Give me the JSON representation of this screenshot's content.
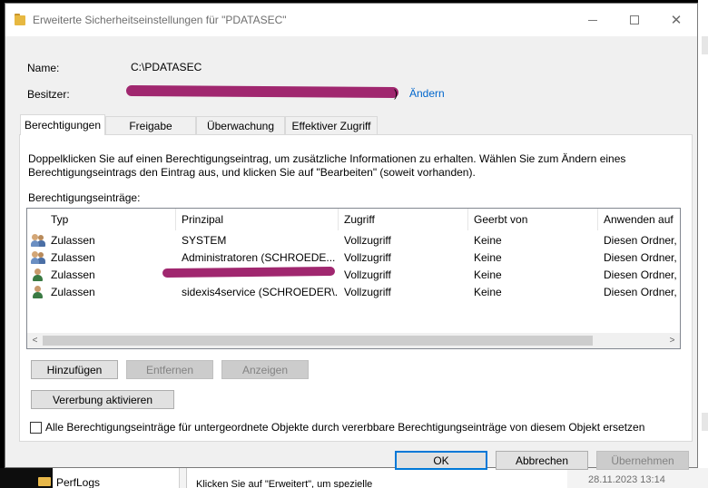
{
  "window": {
    "title": "Erweiterte Sicherheitseinstellungen für \"PDATASEC\"",
    "minimize_glyph": "—",
    "maximize_glyph": "☐",
    "close_glyph": "✕"
  },
  "header": {
    "name_label": "Name:",
    "name_value": "C:\\PDATASEC",
    "owner_label": "Besitzer:",
    "owner_value_tail": ")",
    "change_link": "Ändern"
  },
  "tabs": [
    {
      "label": "Berechtigungen",
      "active": true
    },
    {
      "label": "Freigabe",
      "active": false
    },
    {
      "label": "Überwachung",
      "active": false
    },
    {
      "label": "Effektiver Zugriff",
      "active": false
    }
  ],
  "permissions": {
    "instruction": "Doppelklicken Sie auf einen Berechtigungseintrag, um zusätzliche Informationen zu erhalten. Wählen Sie zum Ändern eines Berechtigungseintrags den Eintrag aus, und klicken Sie auf \"Bearbeiten\" (soweit vorhanden).",
    "entries_label": "Berechtigungseinträge:",
    "columns": [
      "Typ",
      "Prinzipal",
      "Zugriff",
      "Geerbt von",
      "Anwenden auf"
    ],
    "rows": [
      {
        "icon": "group-icon",
        "type": "Zulassen",
        "principal": "SYSTEM",
        "access": "Vollzugriff",
        "inherited": "Keine",
        "applies": "Diesen Ordner, U"
      },
      {
        "icon": "group-icon",
        "type": "Zulassen",
        "principal": "Administratoren (SCHROEDE...",
        "access": "Vollzugriff",
        "inherited": "Keine",
        "applies": "Diesen Ordner, U"
      },
      {
        "icon": "user-icon",
        "type": "Zulassen",
        "principal": "",
        "access": "Vollzugriff",
        "inherited": "Keine",
        "applies": "Diesen Ordner, U"
      },
      {
        "icon": "user-icon",
        "type": "Zulassen",
        "principal": "sidexis4service (SCHROEDER\\...",
        "access": "Vollzugriff",
        "inherited": "Keine",
        "applies": "Diesen Ordner, U"
      }
    ],
    "scroll_left": "<",
    "scroll_right": ">",
    "buttons": {
      "add": "Hinzufügen",
      "remove": "Entfernen",
      "view": "Anzeigen",
      "inherit": "Vererbung aktivieren"
    },
    "replace_checkbox_label": "Alle Berechtigungseinträge für untergeordnete Objekte durch vererbbare Berechtigungseinträge von diesem Objekt ersetzen",
    "replace_checked": false
  },
  "footer": {
    "ok": "OK",
    "cancel": "Abbrechen",
    "apply": "Übernehmen"
  },
  "background": {
    "folder_label": "PerfLogs",
    "mid_text": "Klicken Sie auf \"Erweitert\", um spezielle",
    "date": "28.11.2023 13:14"
  },
  "colors": {
    "accent": "#0078d7",
    "link": "#0066cc",
    "redaction": "#a0276f"
  }
}
